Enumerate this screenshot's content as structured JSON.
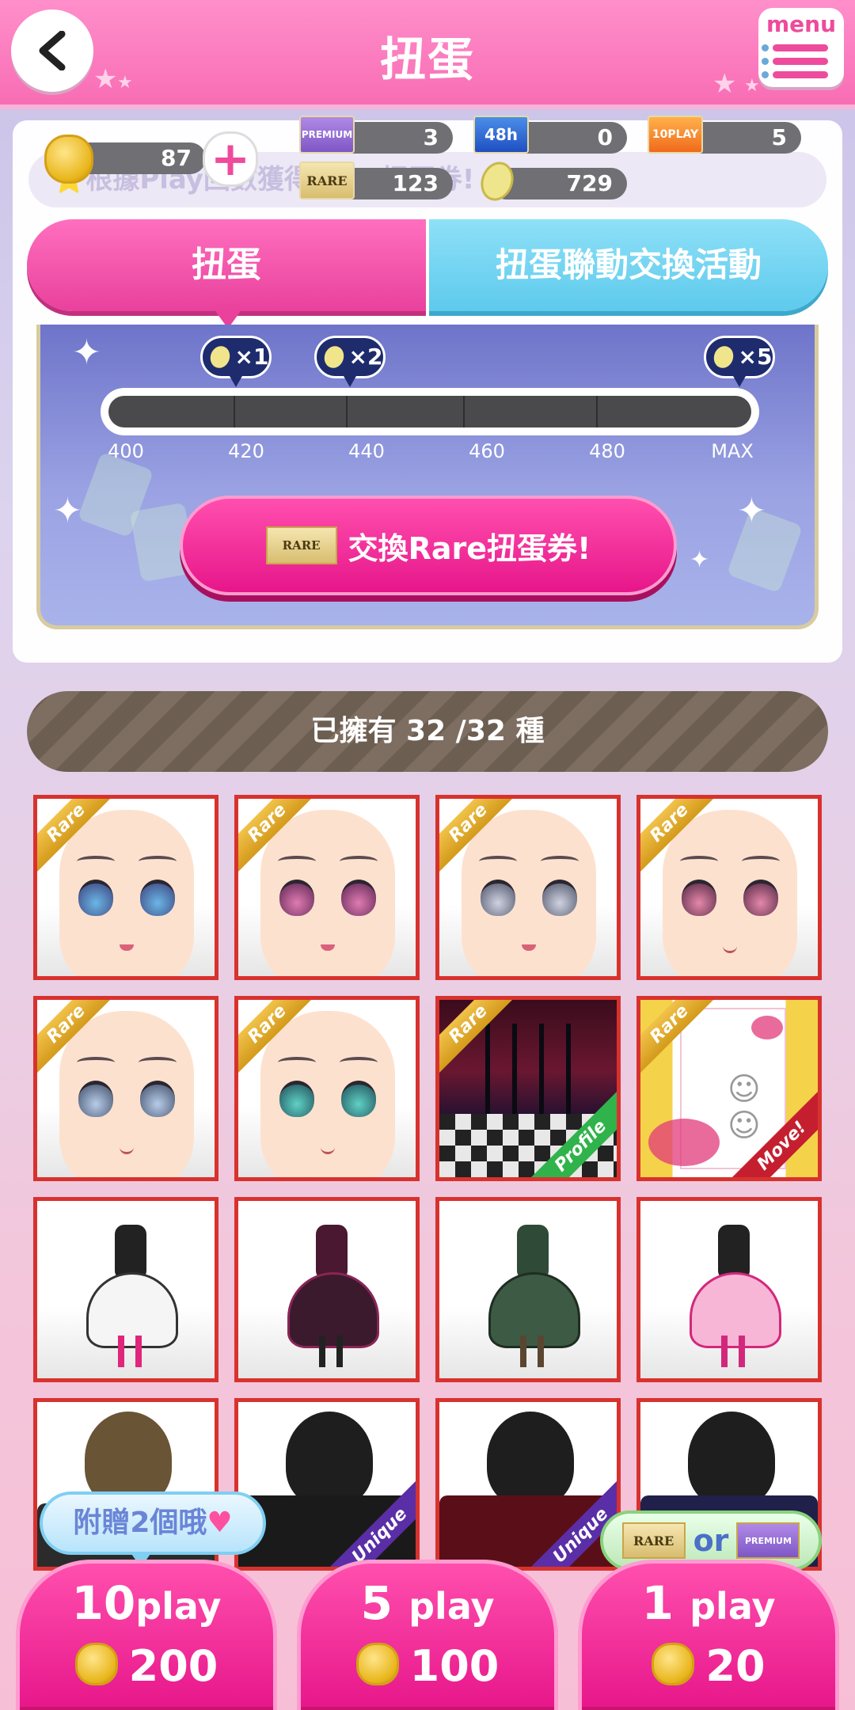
{
  "header": {
    "title": "扭蛋",
    "menu_label": "menu"
  },
  "currency": {
    "coins": "87",
    "premium_ticket_label": "PREMIUM",
    "premium_tickets": "3",
    "h48_ticket_label": "48h",
    "h48_tickets": "0",
    "play10_ticket_label": "10PLAY",
    "play10_tickets": "5",
    "rare_ticket_label": "RARE",
    "rare_tickets": "123",
    "crystals": "729"
  },
  "background_banner": "⭐根據Play回數獲得Rare扭蛋券!",
  "tabs": [
    {
      "label": "扭蛋",
      "active": true
    },
    {
      "label": "扭蛋聯動交換活動",
      "active": false
    }
  ],
  "bonus": {
    "rewards": [
      "×1",
      "×2",
      "×5"
    ],
    "ticks": [
      "400",
      "420",
      "440",
      "460",
      "480",
      "MAX"
    ],
    "progress": 0,
    "button_badge": "RARE",
    "button_label": "交換Rare扭蛋券!"
  },
  "owned": {
    "label": "已擁有 32 /32 種"
  },
  "grid": {
    "rare_label": "Rare",
    "profile_label": "Profile",
    "move_label": "Move!",
    "unique_label": "Unique"
  },
  "play": [
    {
      "count": "10",
      "unit": "play",
      "cost": "200"
    },
    {
      "count": "5",
      "unit": "play",
      "cost": "100"
    },
    {
      "count": "1",
      "unit": "play",
      "cost": "20"
    }
  ],
  "notes": {
    "bonus_text": "附贈2個哦",
    "ticket_rare": "RARE",
    "ticket_or": "or",
    "ticket_premium": "PREMIUM"
  },
  "colors": {
    "accent_pink": "#e7168a",
    "header_pink": "#f86db4",
    "tab_blue": "#5ecaed",
    "owned_brown": "#6d5e52",
    "cell_border": "#d8322e"
  }
}
